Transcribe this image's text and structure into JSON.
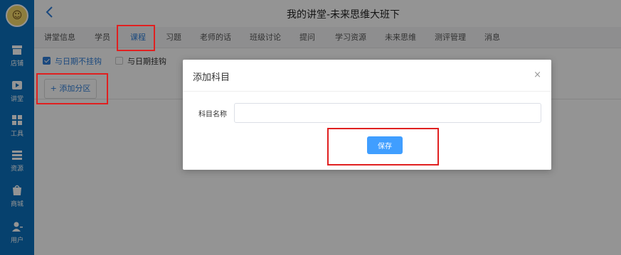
{
  "app": {
    "page_title": "我的讲堂-未来思维大班下"
  },
  "sidebar": {
    "avatar_glyph": "☺",
    "items": [
      {
        "label": "店铺",
        "icon": "store-icon"
      },
      {
        "label": "讲堂",
        "icon": "video-icon"
      },
      {
        "label": "工具",
        "icon": "grid-icon"
      },
      {
        "label": "资源",
        "icon": "list-icon"
      },
      {
        "label": "商城",
        "icon": "shop-icon"
      },
      {
        "label": "用户",
        "icon": "user-icon"
      }
    ]
  },
  "tabs": [
    {
      "label": "讲堂信息"
    },
    {
      "label": "学员"
    },
    {
      "label": "课程",
      "active": true
    },
    {
      "label": "习题"
    },
    {
      "label": "老师的话"
    },
    {
      "label": "班级讨论"
    },
    {
      "label": "提问"
    },
    {
      "label": "学习资源"
    },
    {
      "label": "未来思维"
    },
    {
      "label": "测评管理"
    },
    {
      "label": "消息"
    }
  ],
  "filters": {
    "opt1": {
      "label": "与日期不挂钩",
      "checked": true
    },
    "opt2": {
      "label": "与日期挂钩",
      "checked": false
    }
  },
  "add_zone_button": "+ 添加分区",
  "dialog": {
    "title": "添加科目",
    "close_glyph": "×",
    "field_label": "科目名称",
    "field_value": "",
    "field_placeholder": "",
    "save_label": "保存"
  },
  "colors": {
    "sidebar": "#0b70bd",
    "accent": "#2f7fd9",
    "save_button": "#409eff",
    "annotation": "#e02020"
  }
}
